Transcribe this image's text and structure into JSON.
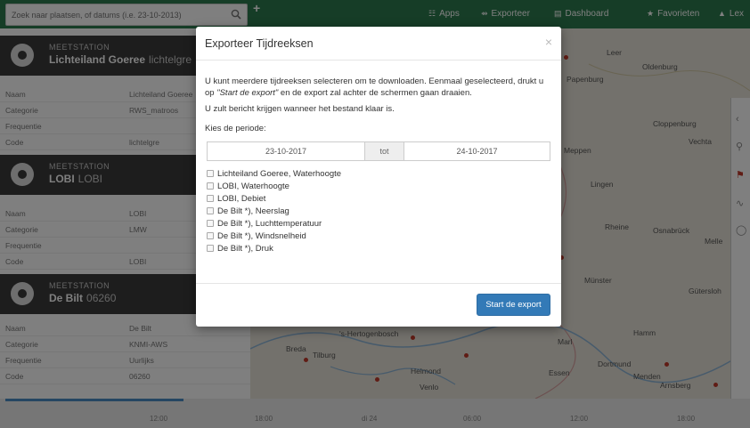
{
  "search": {
    "placeholder": "Zoek naar plaatsen, of datums (i.e. 23-10-2013)"
  },
  "topbar": {
    "apps_label": "Apps",
    "export_label": "Exporteer",
    "dashboard_label": "Dashboard",
    "favorites_label": "Favorieten",
    "user_label": "Lex"
  },
  "stations": [
    {
      "kind": "MEETSTATION",
      "name": "Lichteiland Goeree",
      "code": "lichtelgre",
      "props": [
        {
          "k": "Naam",
          "v": "Lichteiland Goeree"
        },
        {
          "k": "Categorie",
          "v": "RWS_matroos"
        },
        {
          "k": "Frequentie",
          "v": ""
        },
        {
          "k": "Code",
          "v": "lichtelgre"
        }
      ]
    },
    {
      "kind": "MEETSTATION",
      "name": "LOBI",
      "code": "LOBI",
      "props": [
        {
          "k": "Naam",
          "v": "LOBI"
        },
        {
          "k": "Categorie",
          "v": "LMW"
        },
        {
          "k": "Frequentie",
          "v": ""
        },
        {
          "k": "Code",
          "v": "LOBI"
        }
      ]
    },
    {
      "kind": "MEETSTATION",
      "name": "De Bilt",
      "code": "06260",
      "props": [
        {
          "k": "Naam",
          "v": "De Bilt"
        },
        {
          "k": "Categorie",
          "v": "KNMI-AWS"
        },
        {
          "k": "Frequentie",
          "v": "Uurlijks"
        },
        {
          "k": "Code",
          "v": "06260"
        }
      ]
    }
  ],
  "map": {
    "cities": [
      {
        "name": "Leer"
      },
      {
        "name": "Oldenburg"
      },
      {
        "name": "Papenburg"
      },
      {
        "name": "Cloppenburg"
      },
      {
        "name": "Vechta"
      },
      {
        "name": "Meppen"
      },
      {
        "name": "Lingen"
      },
      {
        "name": "Rheine"
      },
      {
        "name": "Osnabrück"
      },
      {
        "name": "Melle"
      },
      {
        "name": "Münster"
      },
      {
        "name": "Gütersloh"
      },
      {
        "name": "Hamm"
      },
      {
        "name": "Dortmund"
      },
      {
        "name": "Menden"
      },
      {
        "name": "Arnsberg"
      },
      {
        "name": "Essen"
      },
      {
        "name": "Breda"
      },
      {
        "name": "Tilburg"
      },
      {
        "name": "'s-Hertogenbosch"
      },
      {
        "name": "Helmond"
      },
      {
        "name": "Venlo"
      },
      {
        "name": "Marl"
      }
    ]
  },
  "timeline": {
    "ticks": [
      "12:00",
      "18:00",
      "di 24",
      "06:00",
      "12:00",
      "18:00"
    ]
  },
  "modal": {
    "title": "Exporteer Tijdreeksen",
    "close_glyph": "×",
    "intro_pre": "U kunt meerdere tijdreeksen selecteren om te downloaden. Eenmaal geselecteerd, drukt u op ",
    "intro_em": "\"Start de export\"",
    "intro_post": " en de export zal achter de schermen gaan draaien.",
    "notice": "U zult bericht krijgen wanneer het bestand klaar is.",
    "period_label": "Kies de periode:",
    "date_from": "23-10-2017",
    "date_sep": "tot",
    "date_to": "24-10-2017",
    "series": [
      "Lichteiland Goeree, Waterhoogte",
      "LOBI, Waterhoogte",
      "LOBI, Debiet",
      "De Bilt *), Neerslag",
      "De Bilt *), Luchttemperatuur",
      "De Bilt *), Windsnelheid",
      "De Bilt *), Druk"
    ],
    "start_button": "Start de export"
  }
}
